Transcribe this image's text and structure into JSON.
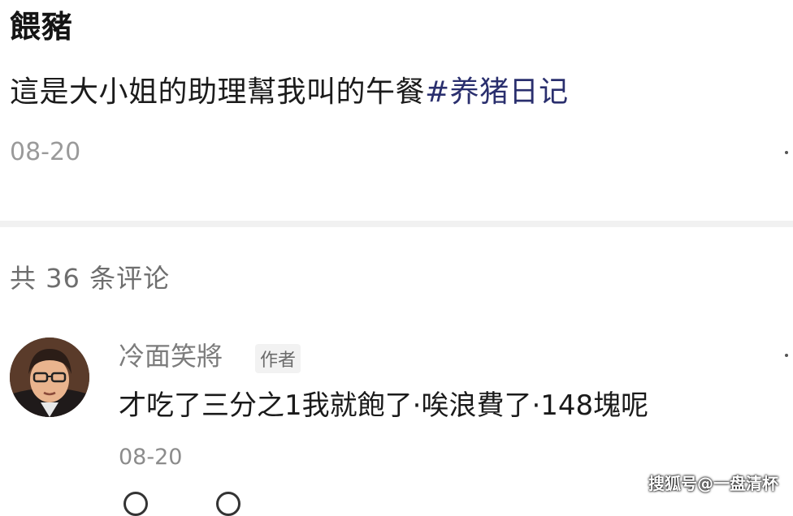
{
  "post": {
    "title": "餵豬",
    "body_text": "這是大小姐的助理幫我叫的午餐",
    "hashtag": "#养猪日记",
    "date": "08-20"
  },
  "comments_header": {
    "count_label": "共 36 条评论"
  },
  "comment": {
    "author": "冷面笑將",
    "author_badge": "作者",
    "text": "才吃了三分之1我就飽了·唉浪費了·148塊呢",
    "date": "08-20",
    "avatar_icon": "person-avatar"
  },
  "watermark": "搜狐号@一盘清杯",
  "icons": {
    "post_more": "more-dots-icon",
    "comment_more": "more-dots-icon",
    "like": "heart-icon",
    "reply": "comment-bubble-icon"
  }
}
